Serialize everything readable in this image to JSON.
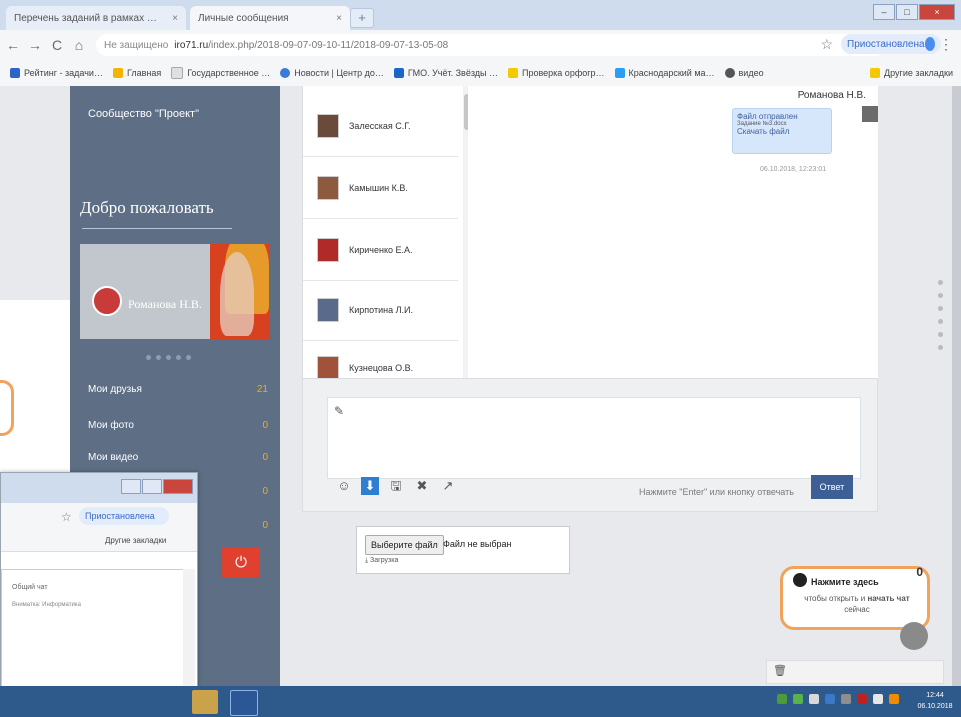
{
  "browser": {
    "tabs": [
      {
        "label": "Перечень заданий в рамках …",
        "active": false
      },
      {
        "label": "Личные сообщения",
        "active": true
      }
    ],
    "address": {
      "secure_label": "Не защищено",
      "domain": "iro71.ru",
      "path": "/index.php/2018-09-07-09-10-11/2018-09-07-13-05-08"
    },
    "sync_label": "Приостановлена",
    "bookmarks": [
      {
        "label": "Рейтинг - задачи…",
        "color": "#2a64c8"
      },
      {
        "label": "Главная",
        "color": "#f5b400"
      },
      {
        "label": "Государственное …",
        "color": "#e0e0e0"
      },
      {
        "label": "Новости | Центр до…",
        "color": "#3a7bd5"
      },
      {
        "label": "ГМО. Учёт. Звёзды …",
        "color": "#1b66c9"
      },
      {
        "label": "Проверка орфогр…",
        "color": "#f5c800"
      },
      {
        "label": "Краснодарский ма…",
        "color": "#2a9df4"
      },
      {
        "label": "видео",
        "color": "#555555"
      }
    ],
    "other_bookmarks": "Другие закладки"
  },
  "sidebar": {
    "community": "Сообщество \"Проект\"",
    "welcome": "Добро пожаловать",
    "user_name": "Романова Н.В.",
    "menu": [
      {
        "label": "Мои друзья",
        "count": "21"
      },
      {
        "label": "Мои фото",
        "count": "0"
      },
      {
        "label": "Мои видео",
        "count": "0"
      },
      {
        "label": "",
        "count": "0"
      },
      {
        "label": "",
        "count": "0"
      }
    ],
    "power_icon": "⏻"
  },
  "contacts": [
    {
      "name": "Залесская С.Г.",
      "color": "#6a4a3a"
    },
    {
      "name": "Камышин К.В.",
      "color": "#8c5a3e"
    },
    {
      "name": "Кириченко Е.А.",
      "color": "#b12a2a"
    },
    {
      "name": "Кирпотина Л.И.",
      "color": "#5a6a8a"
    },
    {
      "name": "Кузнецова О.В.",
      "color": "#a0523a"
    }
  ],
  "chat": {
    "sender": "Романова Н.В.",
    "bubble_title": "Файл отправлен",
    "bubble_sub": "Задание №3.docx",
    "bubble_link": "Скачать файл",
    "timestamp": "06.10.2018, 12:23:01"
  },
  "composer": {
    "placeholder": "",
    "hint": "Нажмите \"Enter\" или кнопку отвечать",
    "send_label": "Ответ",
    "tools": [
      "smile-icon",
      "download-icon",
      "save-icon",
      "close-circle-icon",
      "external-link-icon"
    ]
  },
  "filebox": {
    "choose_label": "Выберите файл",
    "status": "Файл не выбран",
    "link": "Загрузка"
  },
  "chat_widget": {
    "title": "Нажмите здесь",
    "text_pre": "чтобы открыть и",
    "text_bold": "начать чат",
    "text_post": "сейчас",
    "close": "0"
  },
  "second_window": {
    "sync_label": "Приостановлена",
    "other_bookmarks": "Другие закладки",
    "header": "Общий чат",
    "row": "Вниматка: Информатика"
  },
  "taskbar": {
    "clock_time": "12:44",
    "clock_date": "06.10.2018"
  }
}
